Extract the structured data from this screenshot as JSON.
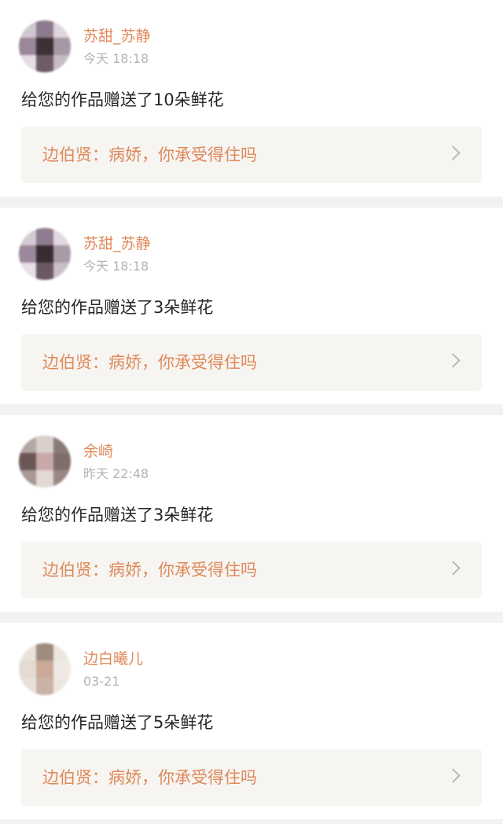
{
  "notifications": [
    {
      "user": "苏甜_苏静",
      "time": "今天 18:18",
      "message": "给您的作品赠送了10朵鲜花",
      "work": "边伯贤：病娇，你承受得住吗",
      "avatar_colors": [
        "#cfc7cf",
        "#8e7a8e",
        "#ddd6dc",
        "#9a879a",
        "#3f3036",
        "#a898a4",
        "#e4dde3",
        "#6e5c68",
        "#c6bcc4"
      ]
    },
    {
      "user": "苏甜_苏静",
      "time": "今天 18:18",
      "message": "给您的作品赠送了3朵鲜花",
      "work": "边伯贤：病娇，你承受得住吗",
      "avatar_colors": [
        "#d4ccd4",
        "#8f7b8f",
        "#e0d9df",
        "#9c889c",
        "#3a2c33",
        "#aa9aa6",
        "#e6dfe5",
        "#6a5864",
        "#cabfc8"
      ]
    },
    {
      "user": "余崎",
      "time": "昨天 22:48",
      "message": "给您的作品赠送了3朵鲜花",
      "work": "边伯贤：病娇，你承受得住吗",
      "avatar_colors": [
        "#b5a7a6",
        "#d9cfcb",
        "#8a7a78",
        "#6b5756",
        "#c9a9a8",
        "#7f6e6c",
        "#a89795",
        "#e2d8d4",
        "#9b8684"
      ]
    },
    {
      "user": "边白曦儿",
      "time": "03-21",
      "message": "给您的作品赠送了5朵鲜花",
      "work": "边伯贤：病娇，你承受得住吗",
      "avatar_colors": [
        "#e9e3dc",
        "#a08c7e",
        "#ece6e0",
        "#e4dcd3",
        "#caa998",
        "#efe9e3",
        "#e8e1da",
        "#c9b3a6",
        "#ede7e1"
      ]
    }
  ]
}
